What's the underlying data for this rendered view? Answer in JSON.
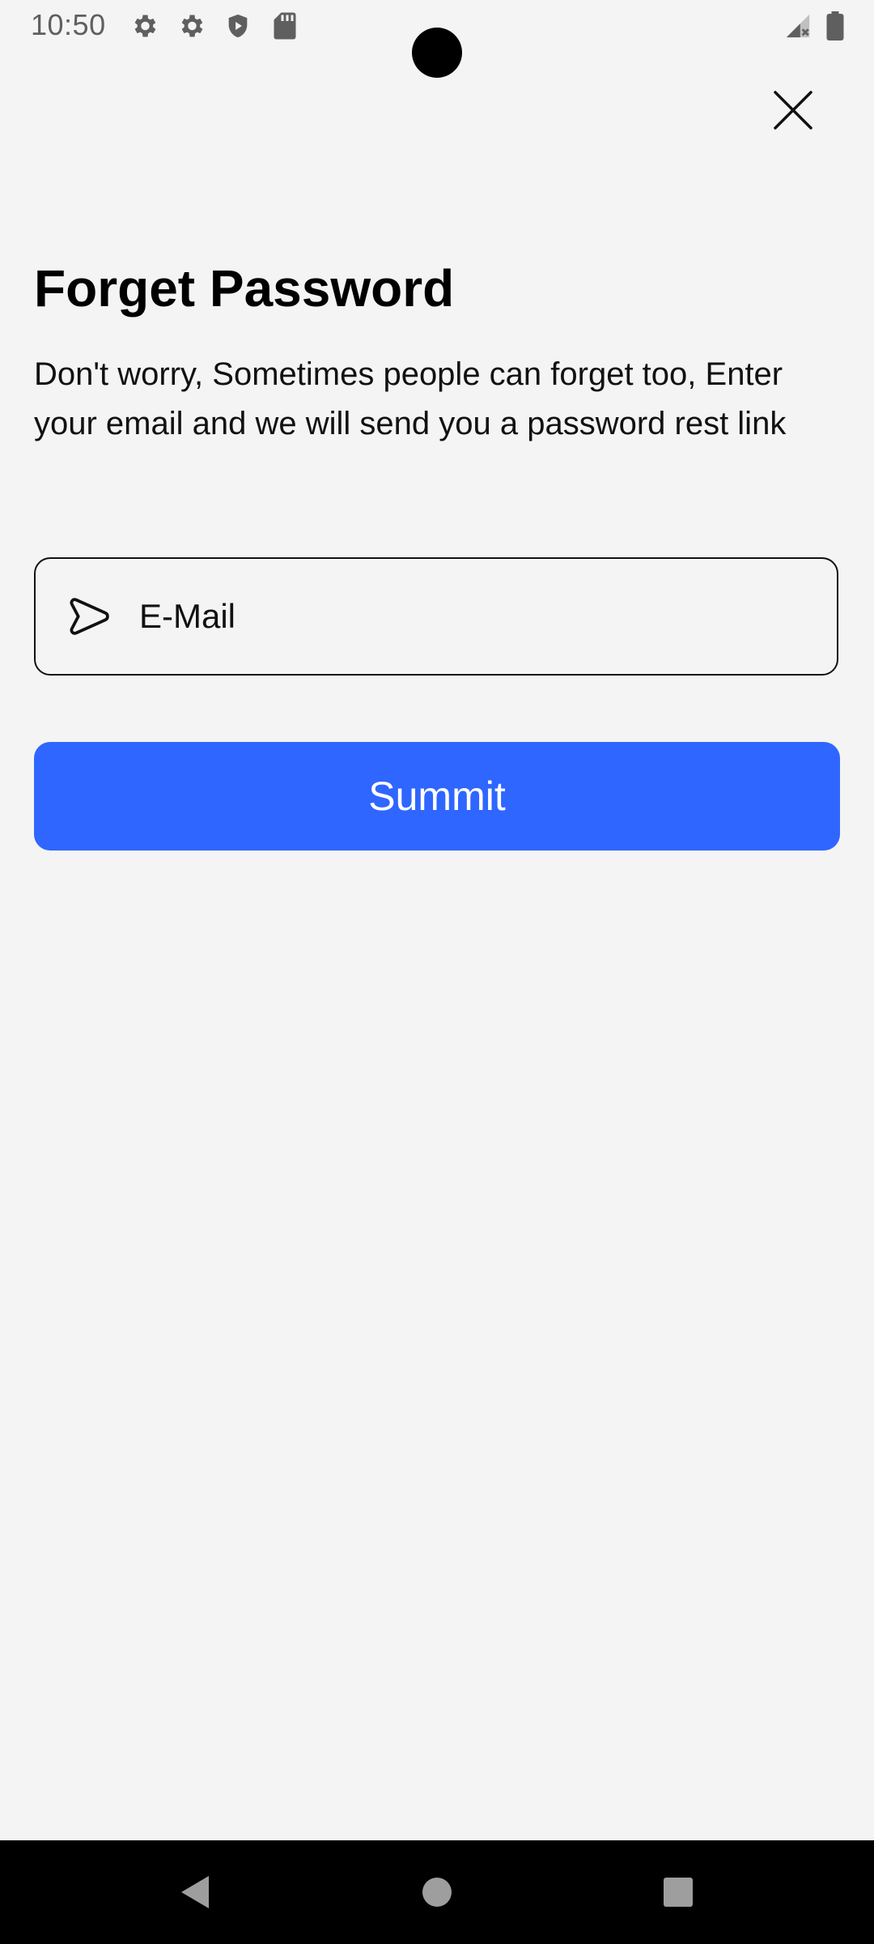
{
  "status_bar": {
    "time": "10:50",
    "left_icons": [
      "gear-icon",
      "gear-icon",
      "shield-icon",
      "sd-card-icon"
    ],
    "right_icons": [
      "signal-icon",
      "battery-icon"
    ]
  },
  "header": {
    "close_icon": "close-icon"
  },
  "main": {
    "title": "Forget Password",
    "description": "Don't worry, Sometimes people can forget too, Enter your email and we will send you a password rest link",
    "email": {
      "placeholder": "E-Mail",
      "value": "",
      "icon": "send-icon"
    },
    "submit_label": "Summit"
  },
  "nav_bar": {
    "items": [
      "back-icon",
      "home-icon",
      "recents-icon"
    ]
  },
  "colors": {
    "background": "#f4f4f4",
    "accent": "#2f66ff",
    "text": "#000000",
    "nav_background": "#000000"
  }
}
